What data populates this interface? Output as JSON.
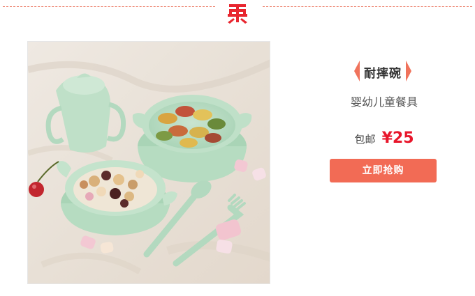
{
  "header": {
    "logo_icon": "red-seal-logo-icon",
    "divider_color": "#ec7f6a"
  },
  "product": {
    "image_alt_icon": "kids-tableware-photo",
    "tag": "耐摔碗",
    "subtitle": "婴幼儿童餐具",
    "price_prefix": "包邮",
    "price": "¥25",
    "buy_label": "立即抢购"
  },
  "colors": {
    "accent": "#f26b55",
    "price": "#e8162b",
    "tag_arrow": "#f0735c"
  }
}
